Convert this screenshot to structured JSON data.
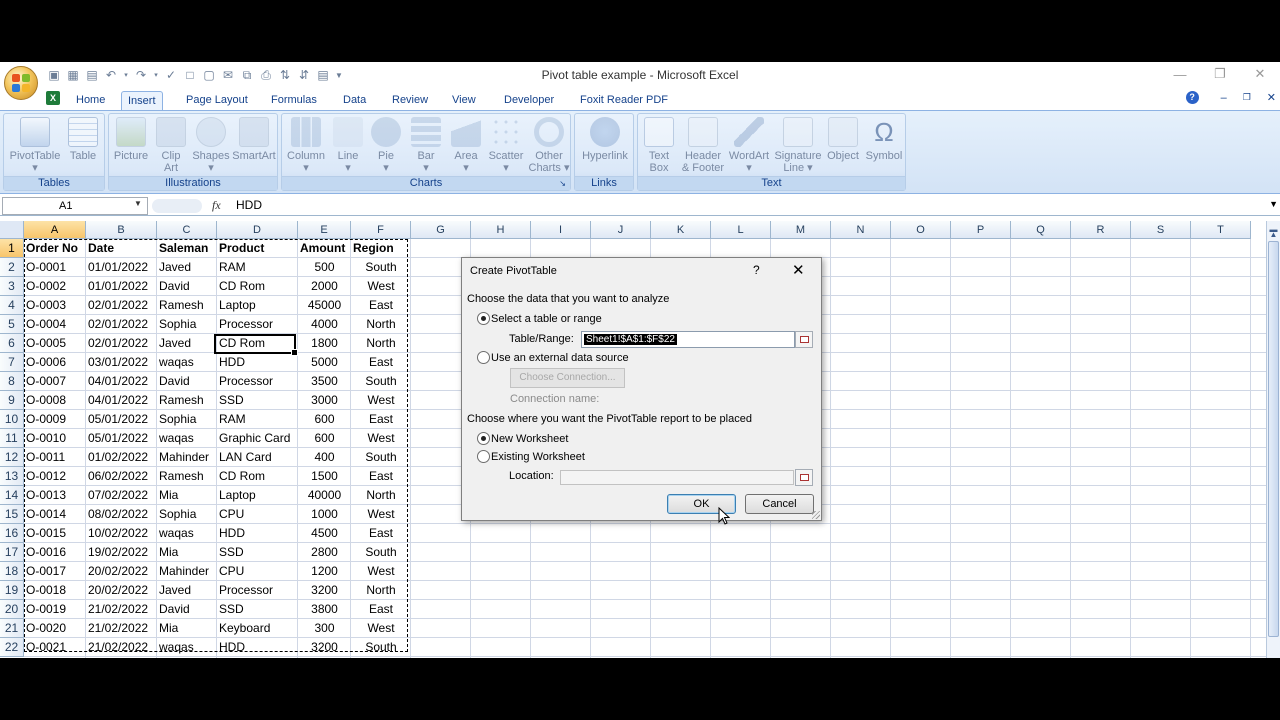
{
  "window": {
    "title": "Pivot table example - Microsoft Excel",
    "minimize": "—",
    "restore": "❐",
    "close": "✕"
  },
  "doc_controls": {
    "help": "?",
    "minimize": "–",
    "restore": "❐",
    "close": "✕"
  },
  "tabs": [
    {
      "label": "Home"
    },
    {
      "label": "Insert"
    },
    {
      "label": "Page Layout"
    },
    {
      "label": "Formulas"
    },
    {
      "label": "Data"
    },
    {
      "label": "Review"
    },
    {
      "label": "View"
    },
    {
      "label": "Developer"
    },
    {
      "label": "Foxit Reader PDF"
    }
  ],
  "ribbon": {
    "groups": [
      {
        "label": "Tables",
        "buttons": [
          "PivotTable",
          "Table"
        ]
      },
      {
        "label": "Illustrations",
        "buttons": [
          "Picture",
          "Clip Art",
          "Shapes",
          "SmartArt"
        ]
      },
      {
        "label": "Charts",
        "buttons": [
          "Column",
          "Line",
          "Pie",
          "Bar",
          "Area",
          "Scatter",
          "Other Charts"
        ]
      },
      {
        "label": "Links",
        "buttons": [
          "Hyperlink"
        ]
      },
      {
        "label": "Text",
        "buttons": [
          "Text Box",
          "Header & Footer",
          "WordArt",
          "Signature Line",
          "Object",
          "Symbol"
        ]
      }
    ],
    "clip_art": [
      "Clip",
      "Art"
    ],
    "other_charts": [
      "Other",
      "Charts"
    ],
    "text_box": [
      "Text",
      "Box"
    ],
    "header_footer": [
      "Header",
      "& Footer"
    ],
    "signature_line": [
      "Signature",
      "Line"
    ]
  },
  "formula_bar": {
    "name_box": "A1",
    "fx": "fx",
    "formula": "HDD"
  },
  "columns": [
    "A",
    "B",
    "C",
    "D",
    "E",
    "F",
    "G",
    "H",
    "I",
    "J",
    "K",
    "L",
    "M",
    "N",
    "O",
    "P",
    "Q",
    "R",
    "S",
    "T"
  ],
  "rows": [
    "1",
    "2",
    "3",
    "4",
    "5",
    "6",
    "7",
    "8",
    "9",
    "10",
    "11",
    "12",
    "13",
    "14",
    "15",
    "16",
    "17",
    "18",
    "19",
    "20",
    "21",
    "22"
  ],
  "sheet": {
    "headers": [
      "Order No",
      "Date",
      "Saleman",
      "Product",
      "Amount",
      "Region"
    ],
    "data": [
      [
        "O-0001",
        "01/01/2022",
        "Javed",
        "RAM",
        "500",
        "South"
      ],
      [
        "O-0002",
        "01/01/2022",
        "David",
        "CD Rom",
        "2000",
        "West"
      ],
      [
        "O-0003",
        "02/01/2022",
        "Ramesh",
        "Laptop",
        "45000",
        "East"
      ],
      [
        "O-0004",
        "02/01/2022",
        "Sophia",
        "Processor",
        "4000",
        "North"
      ],
      [
        "O-0005",
        "02/01/2022",
        "Javed",
        "CD Rom",
        "1800",
        "North"
      ],
      [
        "O-0006",
        "03/01/2022",
        "waqas",
        "HDD",
        "5000",
        "East"
      ],
      [
        "O-0007",
        "04/01/2022",
        "David",
        "Processor",
        "3500",
        "South"
      ],
      [
        "O-0008",
        "04/01/2022",
        "Ramesh",
        "SSD",
        "3000",
        "West"
      ],
      [
        "O-0009",
        "05/01/2022",
        "Sophia",
        "RAM",
        "600",
        "East"
      ],
      [
        "O-0010",
        "05/01/2022",
        "waqas",
        "Graphic Card",
        "600",
        "West"
      ],
      [
        "O-0011",
        "01/02/2022",
        "Mahinder",
        "LAN Card",
        "400",
        "South"
      ],
      [
        "O-0012",
        "06/02/2022",
        "Ramesh",
        "CD Rom",
        "1500",
        "East"
      ],
      [
        "O-0013",
        "07/02/2022",
        "Mia",
        "Laptop",
        "40000",
        "North"
      ],
      [
        "O-0014",
        "08/02/2022",
        "Sophia",
        "CPU",
        "1000",
        "West"
      ],
      [
        "O-0015",
        "10/02/2022",
        "waqas",
        "HDD",
        "4500",
        "East"
      ],
      [
        "O-0016",
        "19/02/2022",
        "Mia",
        "SSD",
        "2800",
        "South"
      ],
      [
        "O-0017",
        "20/02/2022",
        "Mahinder",
        "CPU",
        "1200",
        "West"
      ],
      [
        "O-0018",
        "20/02/2022",
        "Javed",
        "Processor",
        "3200",
        "North"
      ],
      [
        "O-0019",
        "21/02/2022",
        "David",
        "SSD",
        "3800",
        "East"
      ],
      [
        "O-0020",
        "21/02/2022",
        "Mia",
        "Keyboard",
        "300",
        "West"
      ],
      [
        "O-0021",
        "21/02/2022",
        "waqas",
        "HDD",
        "3200",
        "South"
      ]
    ]
  },
  "dialog": {
    "title": "Create PivotTable",
    "help": "?",
    "close": "✕",
    "section1": "Choose the data that you want to analyze",
    "option_table": "Select a table or range",
    "range_label": "Table/Range:",
    "range_value": "Sheet1!$A$1:$F$22",
    "option_external": "Use an external data source",
    "choose_connection": "Choose Connection...",
    "connection_name": "Connection name:",
    "section2": "Choose where you want the PivotTable report to be placed",
    "option_new": "New Worksheet",
    "option_existing": "Existing Worksheet",
    "location_label": "Location:",
    "location_value": "",
    "ok": "OK",
    "cancel": "Cancel"
  },
  "colors": {
    "ribbon_text": "#15428b",
    "selected_header": "#f8c56b",
    "grid_line": "#d0d7e5"
  }
}
